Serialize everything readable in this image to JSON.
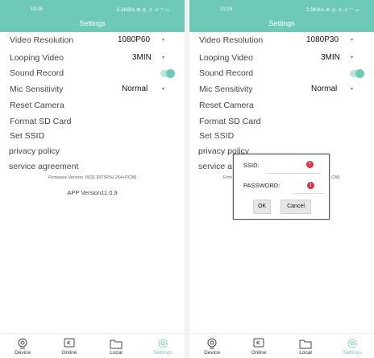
{
  "left": {
    "status": {
      "time": "10:28",
      "right": "0.3KB/s ⊗ ◎ .ıl .ıl ◠ ▭"
    },
    "title": "Settings",
    "video_resolution": {
      "label": "Video Resolution",
      "value": "1080P60"
    },
    "looping_video": {
      "label": "Looping Video",
      "value": "3MIN"
    },
    "sound_record": {
      "label": "Sound Record",
      "on": true
    },
    "mic_sensitivity": {
      "label": "Mic Sensitivity",
      "value": "Normal"
    },
    "reset_camera": "Reset Camera",
    "format_sd": "Format SD Card",
    "set_ssid": "Set SSID",
    "privacy_policy": "privacy policy",
    "service_agreement": "service agreement",
    "firmware": "Firmware Version :0031 [RTSP/H.264+PCM]",
    "app_version": "APP Version11.0.9",
    "tabs": [
      "Device",
      "Online",
      "Local",
      "Settings"
    ]
  },
  "right": {
    "status": {
      "time": "10:29",
      "right": "2.0KB/s ⊗ ◎ .ıl .ıl ◠ ▭"
    },
    "title": "Settings",
    "video_resolution": {
      "label": "Video Resolution",
      "value": "1080P30"
    },
    "looping_video": {
      "label": "Looping Video",
      "value": "3MIN"
    },
    "sound_record": {
      "label": "Sound Record",
      "on": true
    },
    "mic_sensitivity": {
      "label": "Mic Sensitivity",
      "value": "Normal"
    },
    "reset_camera": "Reset Camera",
    "format_sd": "Format SD Card",
    "set_ssid": "Set SSID",
    "privacy_policy": "privacy policy",
    "service_agreement_partial": "service a",
    "firmware_partial": "Firm",
    "firmware_tail": "CM]",
    "dialog": {
      "ssid_label": "SSID:",
      "password_label": "PASSWORD:",
      "alert_icon": "!",
      "ok": "OK",
      "cancel": "Cancel"
    },
    "tabs": [
      "Device",
      "Online",
      "Local",
      "Settings"
    ]
  },
  "icons": {
    "caret": "▾",
    "device": "camera-icon",
    "online": "online-icon",
    "local": "folder-icon",
    "settings": "gear-icon"
  },
  "colors": {
    "accent": "#6ec9b9",
    "alert": "#e0313a"
  }
}
